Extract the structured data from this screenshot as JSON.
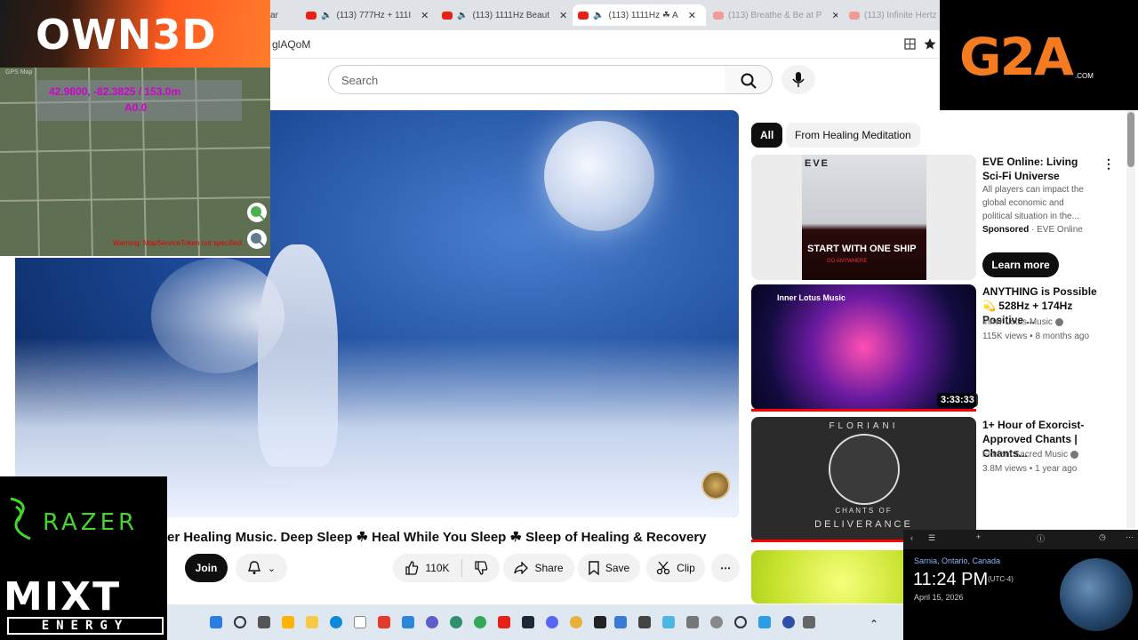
{
  "browser": {
    "tabs": [
      {
        "title": "ar"
      },
      {
        "title": "(113) 777Hz + 111I"
      },
      {
        "title": "(113) 1111Hz Beaut"
      },
      {
        "title": "(113) 1111Hz ☘ A"
      },
      {
        "title": "(113) Breathe & Be at P"
      },
      {
        "title": "(113) Infinite Hertz"
      }
    ],
    "url": "glAQoM"
  },
  "search": {
    "placeholder": "Search"
  },
  "overlays": {
    "own3d": "OWN3D",
    "gps": {
      "title": "GPS Map",
      "coords": "42.9800, -82.3825 / 153.0m",
      "alt": "A0.0",
      "warning": "Warning: MapServiceToken not specified."
    },
    "g2a": "G2A",
    "g2a_com": ".COM",
    "razer": "RAZER",
    "mixt": "MIXT",
    "energy": "ENERGY"
  },
  "video": {
    "title": "er Healing Music. Deep Sleep ☘ Heal While You Sleep ☘ Sleep of Healing & Recovery",
    "join": "Join",
    "likes": "110K",
    "share": "Share",
    "save": "Save",
    "clip": "Clip"
  },
  "chips": {
    "all": "All",
    "healing": "From Healing Meditation"
  },
  "sidebar": {
    "ad": {
      "thumb_title": "EVE",
      "tagline": "START WITH ONE SHIP",
      "subtag": "GO ANYWHERE",
      "title": "EVE Online: Living Sci-Fi Universe",
      "desc": "All players can impact the global economic and political situation in the...",
      "sponsored": "Sponsored",
      "advertiser": "EVE Online",
      "cta": "Learn more"
    },
    "items": [
      {
        "title": "ANYTHING is Possible 💫 528Hz + 174Hz Positive ...",
        "channel": "Inner Lotus Music",
        "meta": "115K views • 8 months ago",
        "duration": "3:33:33",
        "thumb_label": "Inner Lotus Music"
      },
      {
        "title": "1+ Hour of Exorcist-Approved Chants | Chants...",
        "channel": "Floriani Sacred Music",
        "meta": "3.8M views • 1 year ago",
        "thumb_top": "FLORIANI",
        "thumb_chants": "CHANTS OF",
        "thumb_deliv": "DELIVERANCE"
      }
    ]
  },
  "clock": {
    "location": "Sarnia, Ontario, Canada",
    "time": "11:24 PM",
    "tz": "(UTC-4)",
    "date": "April 15, 2026"
  },
  "colors": {
    "youtube_red": "#ff0000",
    "gps_magenta": "#d100d1",
    "razer_green": "#44d62c",
    "g2a_orange": "#f47b20"
  }
}
